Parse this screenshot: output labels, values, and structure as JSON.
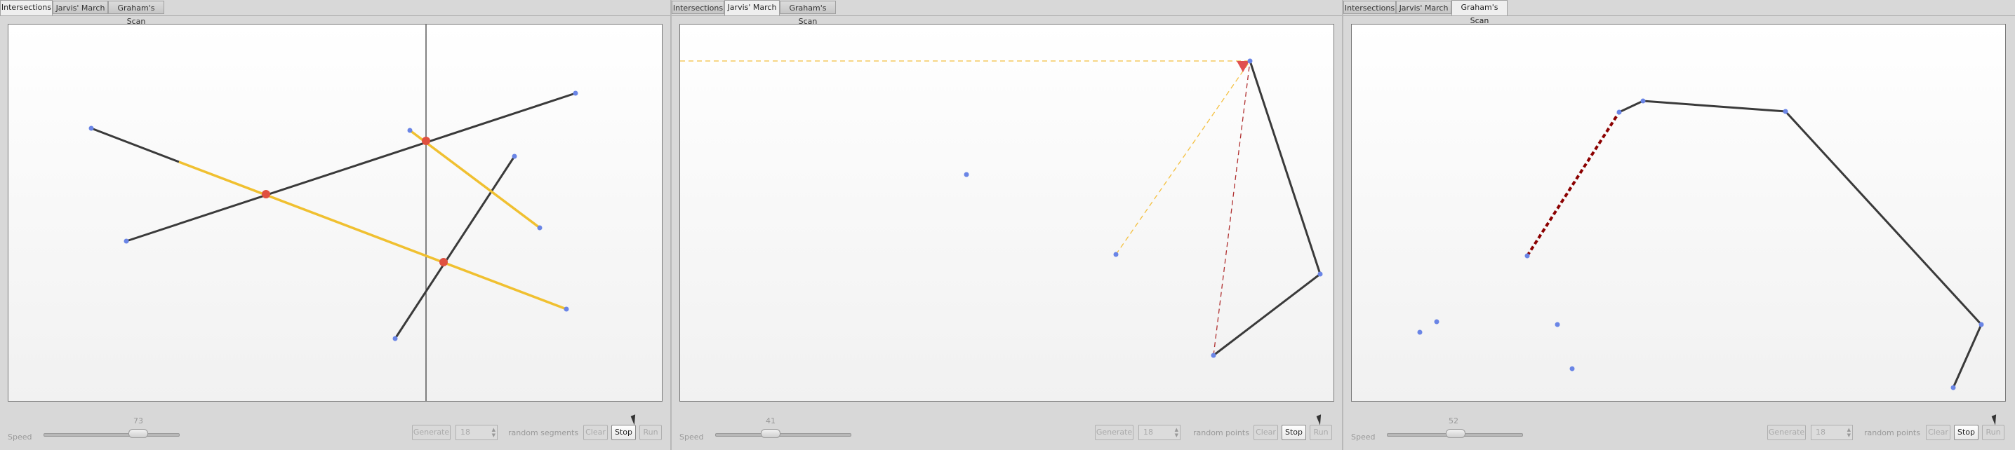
{
  "tabs": [
    "Intersections",
    "Jarvis' March",
    "Graham's Scan"
  ],
  "panels": [
    {
      "active_tab": 0,
      "speed_label": "Speed",
      "speed_value": "73",
      "speed_fraction": 0.73,
      "buttons": {
        "generate": "Generate",
        "clear": "Clear",
        "stop": "Stop",
        "run": "Run"
      },
      "count_value": "18",
      "count_label": "random segments"
    },
    {
      "active_tab": 1,
      "speed_label": "Speed",
      "speed_value": "41",
      "speed_fraction": 0.41,
      "buttons": {
        "generate": "Generate",
        "clear": "Clear",
        "stop": "Stop",
        "run": "Run"
      },
      "count_value": "18",
      "count_label": "random points"
    },
    {
      "active_tab": 2,
      "speed_label": "Speed",
      "speed_value": "52",
      "speed_fraction": 0.52,
      "buttons": {
        "generate": "Generate",
        "clear": "Clear",
        "stop": "Stop",
        "run": "Run"
      },
      "count_value": "18",
      "count_label": "random points"
    }
  ],
  "colors": {
    "segment": "#3a3a3a",
    "highlight_segment": "#f0c030",
    "point": "#6a85e6",
    "intersection": "#e05040",
    "candidate_line": "#b03030",
    "probe_line": "#f4c040",
    "hull_edge": "#8b0000"
  },
  "icons": [
    "mouse-cursor-icon",
    "spinner-arrows-icon",
    "slider-thumb-icon"
  ]
}
